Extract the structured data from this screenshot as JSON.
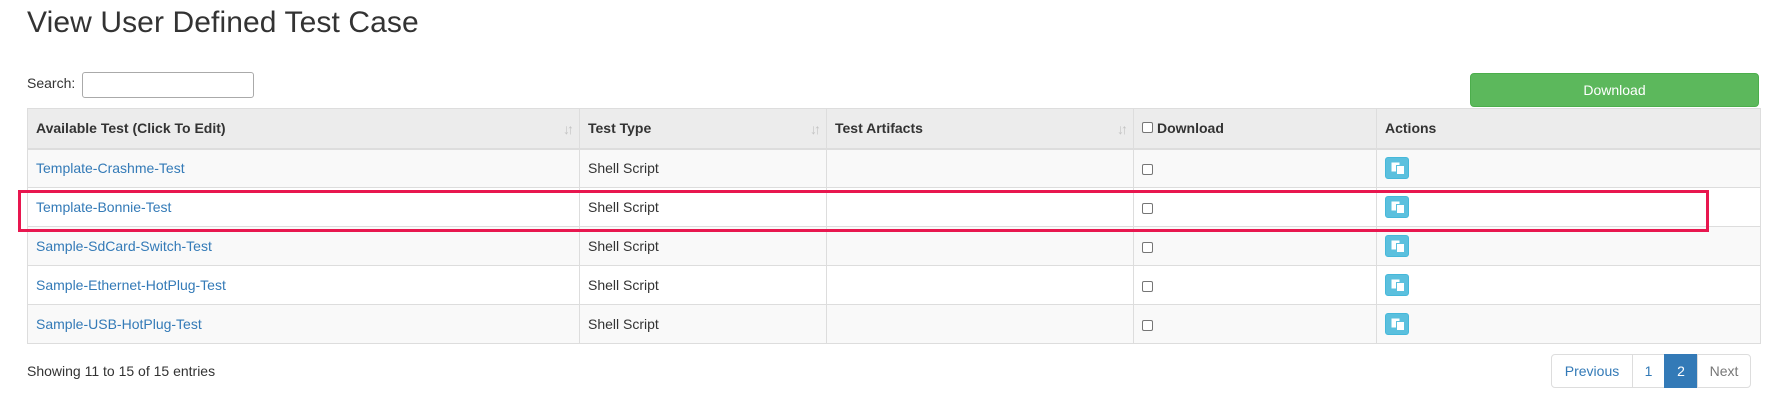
{
  "page": {
    "title": "View User Defined Test Case"
  },
  "search": {
    "label": "Search:",
    "value": ""
  },
  "download_button": {
    "label": "Download"
  },
  "table": {
    "headers": {
      "available_test": "Available Test (Click To Edit)",
      "test_type": "Test Type",
      "test_artifacts": "Test Artifacts",
      "download": "Download",
      "actions": "Actions"
    },
    "rows": [
      {
        "name": "Template-Crashme-Test",
        "type": "Shell Script",
        "artifacts": ""
      },
      {
        "name": "Template-Bonnie-Test",
        "type": "Shell Script",
        "artifacts": ""
      },
      {
        "name": "Sample-SdCard-Switch-Test",
        "type": "Shell Script",
        "artifacts": ""
      },
      {
        "name": "Sample-Ethernet-HotPlug-Test",
        "type": "Shell Script",
        "artifacts": ""
      },
      {
        "name": "Sample-USB-HotPlug-Test",
        "type": "Shell Script",
        "artifacts": ""
      }
    ]
  },
  "footer": {
    "info": "Showing 11 to 15 of 15 entries"
  },
  "pagination": {
    "previous": "Previous",
    "page1": "1",
    "page2": "2",
    "next": "Next"
  },
  "colors": {
    "accent": "#337ab7",
    "success": "#5cb85c",
    "info": "#5bc0de",
    "highlight": "#e8174f"
  },
  "icons": {
    "sort": "sort-icon",
    "action": "copy-icon"
  }
}
